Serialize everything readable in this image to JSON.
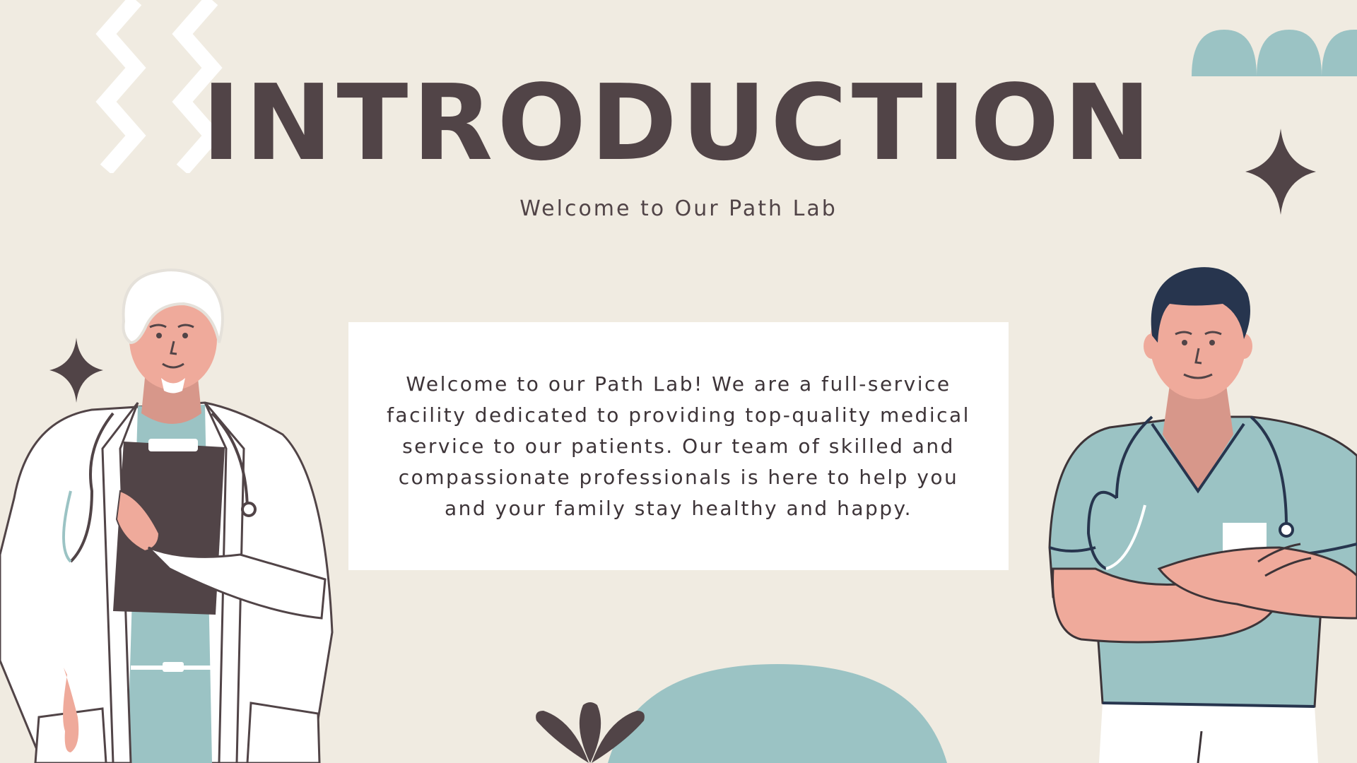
{
  "slide": {
    "title": "INTRODUCTION",
    "subtitle": "Welcome to Our Path Lab",
    "body": "Welcome to our Path Lab! We are a full-service facility dedicated to providing top-quality medical service to our patients. Our team of skilled and compassionate professionals is here to help you and your family stay healthy and happy."
  },
  "colors": {
    "background": "#f0ebe1",
    "title": "#514447",
    "accent_teal": "#9bc3c4",
    "accent_dark": "#514447",
    "card": "#ffffff"
  },
  "decorations": [
    "zigzag-lines",
    "teal-clouds",
    "four-point-stars",
    "teal-semicircle",
    "dark-leaf-plant",
    "doctor-illustration",
    "nurse-illustration"
  ]
}
